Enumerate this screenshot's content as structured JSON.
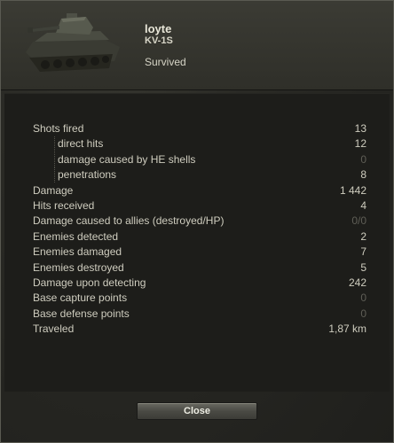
{
  "header": {
    "player_name": "loyte",
    "vehicle_name": "KV-1S",
    "status": "Survived",
    "tank_image_icon": "tank-silhouette"
  },
  "stats": [
    {
      "label": "Shots fired",
      "value": "13",
      "indent": false,
      "dim": false
    },
    {
      "label": "direct hits",
      "value": "12",
      "indent": true,
      "dim": false
    },
    {
      "label": "damage caused by HE shells",
      "value": "0",
      "indent": true,
      "dim": true
    },
    {
      "label": "penetrations",
      "value": "8",
      "indent": true,
      "dim": false
    },
    {
      "label": "Damage",
      "value": "1 442",
      "indent": false,
      "dim": false
    },
    {
      "label": "Hits received",
      "value": "4",
      "indent": false,
      "dim": false
    },
    {
      "label": "Damage caused to allies (destroyed/HP)",
      "value": "0/0",
      "indent": false,
      "dim": true
    },
    {
      "label": "Enemies detected",
      "value": "2",
      "indent": false,
      "dim": false
    },
    {
      "label": "Enemies damaged",
      "value": "7",
      "indent": false,
      "dim": false
    },
    {
      "label": "Enemies destroyed",
      "value": "5",
      "indent": false,
      "dim": false
    },
    {
      "label": "Damage upon detecting",
      "value": "242",
      "indent": false,
      "dim": false
    },
    {
      "label": "Base capture points",
      "value": "0",
      "indent": false,
      "dim": true
    },
    {
      "label": "Base defense points",
      "value": "0",
      "indent": false,
      "dim": true
    },
    {
      "label": "Traveled",
      "value": "1,87 km",
      "indent": false,
      "dim": false
    }
  ],
  "footer": {
    "close_label": "Close"
  },
  "colors": {
    "text": "#cfcdbf",
    "dim_value": "#5f5e56",
    "panel": "#1d1d1a"
  }
}
